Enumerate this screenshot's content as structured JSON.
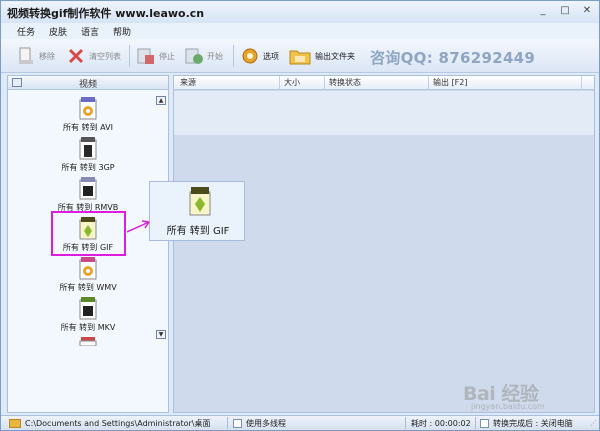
{
  "window": {
    "title": "视频转换gif制作软件 www.leawo.cn",
    "controls": [
      "_",
      "□",
      "✕"
    ]
  },
  "menu": [
    "任务",
    "皮肤",
    "语言",
    "帮助"
  ],
  "toolbar": {
    "remove": "移除",
    "clear_list": "清空列表",
    "stop": "停止",
    "start": "开始",
    "options": "选项",
    "output_folder": "输出文件夹",
    "promo": "咨询QQ: 876292449"
  },
  "left_panel": {
    "header": "视频",
    "formats": [
      {
        "badge": "AVI",
        "label": "所有 转到 AVI"
      },
      {
        "badge": "3GP",
        "label": "所有 转到 3GP"
      },
      {
        "badge": "RMVB",
        "label": "所有 转到 RMVB"
      },
      {
        "badge": "GIF",
        "label": "所有 转到 GIF"
      },
      {
        "badge": "WMV",
        "label": "所有 转到 WMV"
      },
      {
        "badge": "MKV",
        "label": "所有 转到 MKV"
      }
    ]
  },
  "popup": {
    "badge": "GIF",
    "label": "所有 转到 GIF"
  },
  "table": {
    "columns": [
      "来源",
      "大小",
      "转换状态",
      "输出 [F2]"
    ]
  },
  "statusbar": {
    "path": "C:\\Documents and Settings\\Administrator\\桌面",
    "multithread": "使用多线程",
    "elapsed": "耗时 : 00:00:02",
    "after_convert": "转换完成后 : 关闭电脑"
  },
  "watermark": {
    "text": "Bai 经验",
    "url": "jingyan.baidu.com"
  },
  "colors": {
    "highlight": "#e01be0",
    "promo": "#8fa5c2"
  }
}
